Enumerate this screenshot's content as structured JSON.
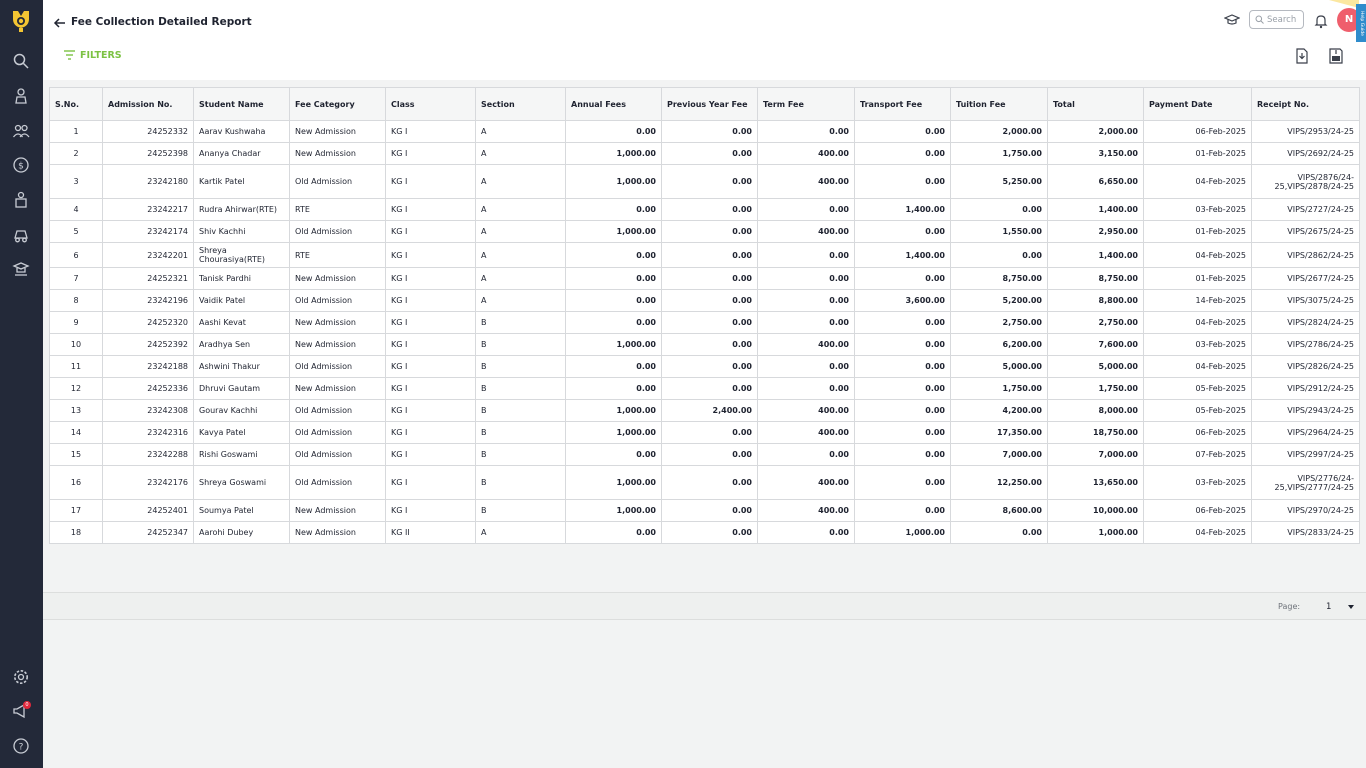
{
  "app": {
    "title": "Fee Collection Detailed Report",
    "filters_label": "FILTERS",
    "search_placeholder": "Search",
    "avatar_initial": "N",
    "help_tab_label": "Help Guide",
    "notification_count": "0",
    "accent_color": "#7cc243",
    "sidebar_color": "#232939"
  },
  "sidebar": {
    "icons": [
      "logo-icon",
      "search-icon",
      "student-icon",
      "users-icon",
      "fees-icon",
      "staff-icon",
      "transport-icon",
      "academics-icon",
      "settings-icon",
      "announcements-icon",
      "help-icon"
    ]
  },
  "table": {
    "headers": [
      "S.No.",
      "Admission No.",
      "Student Name",
      "Fee Category",
      "Class",
      "Section",
      "Annual Fees",
      "Previous Year Fee",
      "Term Fee",
      "Transport Fee",
      "Tuition Fee",
      "Total",
      "Payment Date",
      "Receipt No."
    ],
    "rows": [
      [
        "1",
        "24252332",
        "Aarav Kushwaha",
        "New Admission",
        "KG I",
        "A",
        "0.00",
        "0.00",
        "0.00",
        "0.00",
        "2,000.00",
        "2,000.00",
        "06-Feb-2025",
        "VIPS/2953/24-25"
      ],
      [
        "2",
        "24252398",
        "Ananya Chadar",
        "New Admission",
        "KG I",
        "A",
        "1,000.00",
        "0.00",
        "400.00",
        "0.00",
        "1,750.00",
        "3,150.00",
        "01-Feb-2025",
        "VIPS/2692/24-25"
      ],
      [
        "3",
        "23242180",
        "Kartik Patel",
        "Old Admission",
        "KG I",
        "A",
        "1,000.00",
        "0.00",
        "400.00",
        "0.00",
        "5,250.00",
        "6,650.00",
        "04-Feb-2025",
        "VIPS/2876/24-25,VIPS/2878/24-25"
      ],
      [
        "4",
        "23242217",
        "Rudra Ahirwar(RTE)",
        "RTE",
        "KG I",
        "A",
        "0.00",
        "0.00",
        "0.00",
        "1,400.00",
        "0.00",
        "1,400.00",
        "03-Feb-2025",
        "VIPS/2727/24-25"
      ],
      [
        "5",
        "23242174",
        "Shiv Kachhi",
        "Old Admission",
        "KG I",
        "A",
        "1,000.00",
        "0.00",
        "400.00",
        "0.00",
        "1,550.00",
        "2,950.00",
        "01-Feb-2025",
        "VIPS/2675/24-25"
      ],
      [
        "6",
        "23242201",
        "Shreya Chourasiya(RTE)",
        "RTE",
        "KG I",
        "A",
        "0.00",
        "0.00",
        "0.00",
        "1,400.00",
        "0.00",
        "1,400.00",
        "04-Feb-2025",
        "VIPS/2862/24-25"
      ],
      [
        "7",
        "24252321",
        "Tanisk Pardhi",
        "New Admission",
        "KG I",
        "A",
        "0.00",
        "0.00",
        "0.00",
        "0.00",
        "8,750.00",
        "8,750.00",
        "01-Feb-2025",
        "VIPS/2677/24-25"
      ],
      [
        "8",
        "23242196",
        "Vaidik Patel",
        "Old Admission",
        "KG I",
        "A",
        "0.00",
        "0.00",
        "0.00",
        "3,600.00",
        "5,200.00",
        "8,800.00",
        "14-Feb-2025",
        "VIPS/3075/24-25"
      ],
      [
        "9",
        "24252320",
        "Aashi Kevat",
        "New Admission",
        "KG I",
        "B",
        "0.00",
        "0.00",
        "0.00",
        "0.00",
        "2,750.00",
        "2,750.00",
        "04-Feb-2025",
        "VIPS/2824/24-25"
      ],
      [
        "10",
        "24252392",
        "Aradhya Sen",
        "New Admission",
        "KG I",
        "B",
        "1,000.00",
        "0.00",
        "400.00",
        "0.00",
        "6,200.00",
        "7,600.00",
        "03-Feb-2025",
        "VIPS/2786/24-25"
      ],
      [
        "11",
        "23242188",
        "Ashwini Thakur",
        "Old Admission",
        "KG I",
        "B",
        "0.00",
        "0.00",
        "0.00",
        "0.00",
        "5,000.00",
        "5,000.00",
        "04-Feb-2025",
        "VIPS/2826/24-25"
      ],
      [
        "12",
        "24252336",
        "Dhruvi Gautam",
        "New Admission",
        "KG I",
        "B",
        "0.00",
        "0.00",
        "0.00",
        "0.00",
        "1,750.00",
        "1,750.00",
        "05-Feb-2025",
        "VIPS/2912/24-25"
      ],
      [
        "13",
        "23242308",
        "Gourav Kachhi",
        "Old Admission",
        "KG I",
        "B",
        "1,000.00",
        "2,400.00",
        "400.00",
        "0.00",
        "4,200.00",
        "8,000.00",
        "05-Feb-2025",
        "VIPS/2943/24-25"
      ],
      [
        "14",
        "23242316",
        "Kavya Patel",
        "Old Admission",
        "KG I",
        "B",
        "1,000.00",
        "0.00",
        "400.00",
        "0.00",
        "17,350.00",
        "18,750.00",
        "06-Feb-2025",
        "VIPS/2964/24-25"
      ],
      [
        "15",
        "23242288",
        "Rishi Goswami",
        "Old Admission",
        "KG I",
        "B",
        "0.00",
        "0.00",
        "0.00",
        "0.00",
        "7,000.00",
        "7,000.00",
        "07-Feb-2025",
        "VIPS/2997/24-25"
      ],
      [
        "16",
        "23242176",
        "Shreya Goswami",
        "Old Admission",
        "KG I",
        "B",
        "1,000.00",
        "0.00",
        "400.00",
        "0.00",
        "12,250.00",
        "13,650.00",
        "03-Feb-2025",
        "VIPS/2776/24-25,VIPS/2777/24-25"
      ],
      [
        "17",
        "24252401",
        "Soumya Patel",
        "New Admission",
        "KG I",
        "B",
        "1,000.00",
        "0.00",
        "400.00",
        "0.00",
        "8,600.00",
        "10,000.00",
        "06-Feb-2025",
        "VIPS/2970/24-25"
      ],
      [
        "18",
        "24252347",
        "Aarohi Dubey",
        "New Admission",
        "KG II",
        "A",
        "0.00",
        "0.00",
        "0.00",
        "1,000.00",
        "0.00",
        "1,000.00",
        "04-Feb-2025",
        "VIPS/2833/24-25"
      ]
    ]
  },
  "pagination": {
    "label": "Page:",
    "current": "1"
  }
}
